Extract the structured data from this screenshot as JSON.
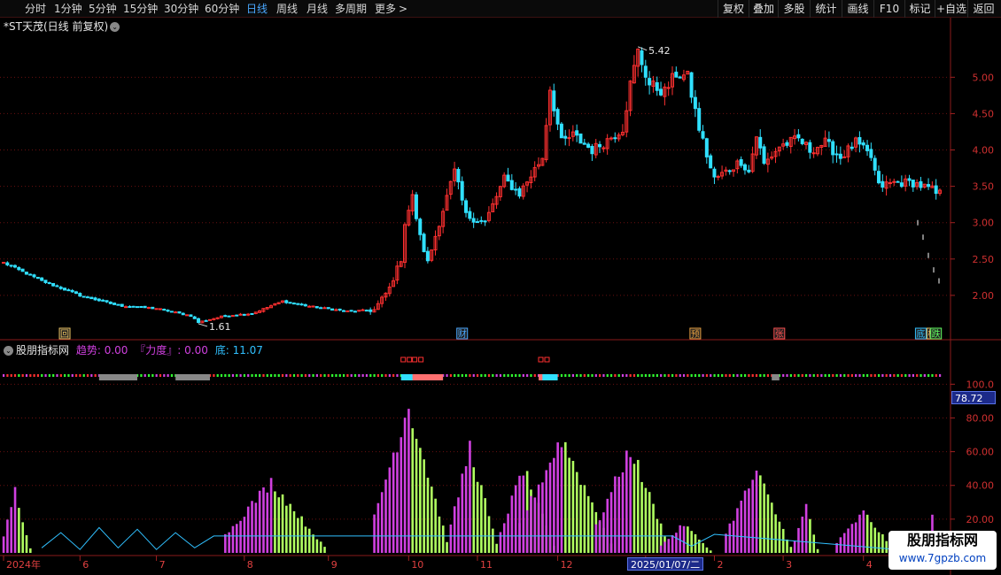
{
  "toolbar": {
    "periods": [
      {
        "label": "分时",
        "name": "tab-minute"
      },
      {
        "label": "1分钟",
        "name": "tab-1min"
      },
      {
        "label": "5分钟",
        "name": "tab-5min"
      },
      {
        "label": "15分钟",
        "name": "tab-15min"
      },
      {
        "label": "30分钟",
        "name": "tab-30min"
      },
      {
        "label": "60分钟",
        "name": "tab-60min"
      },
      {
        "label": "日线",
        "name": "tab-daily"
      },
      {
        "label": "周线",
        "name": "tab-weekly"
      },
      {
        "label": "月线",
        "name": "tab-monthly"
      },
      {
        "label": "多周期",
        "name": "tab-multi-period"
      },
      {
        "label": "更多",
        "name": "tab-more"
      }
    ],
    "more_arrow": ">",
    "active_index": 6,
    "right_buttons": [
      {
        "label": "复权",
        "name": "adjust-button"
      },
      {
        "label": "叠加",
        "name": "overlay-button"
      },
      {
        "label": "多股",
        "name": "multi-stock-button"
      },
      {
        "label": "统计",
        "name": "stats-button"
      },
      {
        "label": "画线",
        "name": "draw-line-button"
      },
      {
        "label": "F10",
        "name": "f10-button"
      },
      {
        "label": "标记",
        "name": "mark-button"
      },
      {
        "label": "+自选",
        "name": "add-watchlist-button"
      },
      {
        "label": "返回",
        "name": "back-button"
      }
    ]
  },
  "price_panel": {
    "title": "*ST天茂(日线 前复权)",
    "high_label": "5.42",
    "low_label": "1.61",
    "event_markers": [
      {
        "text": "回",
        "date": "2024-05-28",
        "color": "#e8c060"
      },
      {
        "text": "财",
        "date": "2024-10-28",
        "color": "#4aa8ff"
      },
      {
        "text": "预",
        "date": "2025-01-21",
        "color": "#e8a040"
      },
      {
        "text": "张",
        "date": "2025-02-28",
        "color": "#ff5050"
      },
      {
        "text": "底",
        "date": "2025-04-22",
        "color": "#30c0ff"
      },
      {
        "text": "榜",
        "date": "2025-04-25",
        "color": "#e8c060"
      },
      {
        "text": "跌",
        "date": "2025-04-28",
        "color": "#60ff60"
      }
    ]
  },
  "indicator_panel": {
    "name": "股朋指标网",
    "trend_label": "趋势",
    "trend_value": "0.00",
    "force_label": "『力度』",
    "force_value": "0.00",
    "bottom_label": "底",
    "bottom_value": "11.07",
    "current_value": "78.72"
  },
  "date_axis": {
    "cursor_date": "2025/01/07/二"
  },
  "watermark": {
    "title": "股朋指标网",
    "url": "www.7gpzb.com"
  },
  "colors": {
    "up": "#ff3030",
    "down": "#30e0ff",
    "magenta_bar": "#d040e0",
    "green_bar": "#b0ff60",
    "line": "#30c0ff",
    "grid": "#6a1010"
  },
  "chart_data": [
    {
      "type": "candlestick",
      "ylim": [
        1.5,
        5.6
      ],
      "ytick_labels": [
        "2.00",
        "2.50",
        "3.00",
        "3.50",
        "4.00",
        "4.50",
        "5.00"
      ],
      "yticks": [
        2.0,
        2.5,
        3.0,
        3.5,
        4.0,
        4.5,
        5.0
      ],
      "xaxis": {
        "ticks": [
          {
            "label": "2024年",
            "date": "2024-05-06"
          },
          {
            "label": "6",
            "date": "2024-06-03"
          },
          {
            "label": "7",
            "date": "2024-07-01"
          },
          {
            "label": "8",
            "date": "2024-08-01"
          },
          {
            "label": "9",
            "date": "2024-09-02"
          },
          {
            "label": "10",
            "date": "2024-10-08"
          },
          {
            "label": "11",
            "date": "2024-11-01"
          },
          {
            "label": "12",
            "date": "2024-12-02"
          },
          {
            "label": "1",
            "date": "2025-01-02"
          },
          {
            "label": "2",
            "date": "2025-02-05"
          },
          {
            "label": "3",
            "date": "2025-03-03"
          },
          {
            "label": "4",
            "date": "2025-04-01"
          }
        ]
      },
      "anchors": [
        {
          "date": "2024-05-06",
          "close": 2.45
        },
        {
          "date": "2024-05-20",
          "close": 2.2
        },
        {
          "date": "2024-06-03",
          "close": 2.0
        },
        {
          "date": "2024-06-17",
          "close": 1.86
        },
        {
          "date": "2024-07-01",
          "close": 1.82
        },
        {
          "date": "2024-07-12",
          "close": 1.72
        },
        {
          "date": "2024-07-16",
          "close": 1.63
        },
        {
          "date": "2024-07-25",
          "close": 1.72
        },
        {
          "date": "2024-08-05",
          "close": 1.75
        },
        {
          "date": "2024-08-15",
          "close": 1.92
        },
        {
          "date": "2024-08-26",
          "close": 1.85
        },
        {
          "date": "2024-09-09",
          "close": 1.78
        },
        {
          "date": "2024-09-18",
          "close": 1.8
        },
        {
          "date": "2024-09-24",
          "close": 2.1
        },
        {
          "date": "2024-09-27",
          "close": 2.5
        },
        {
          "date": "2024-09-30",
          "close": 3.0
        },
        {
          "date": "2024-10-09",
          "close": 3.35
        },
        {
          "date": "2024-10-11",
          "close": 2.8
        },
        {
          "date": "2024-10-15",
          "close": 2.45
        },
        {
          "date": "2024-10-18",
          "close": 3.0
        },
        {
          "date": "2024-10-24",
          "close": 3.7
        },
        {
          "date": "2024-10-29",
          "close": 3.1
        },
        {
          "date": "2024-11-05",
          "close": 3.0
        },
        {
          "date": "2024-11-12",
          "close": 3.6
        },
        {
          "date": "2024-11-18",
          "close": 3.4
        },
        {
          "date": "2024-11-26",
          "close": 3.9
        },
        {
          "date": "2024-11-28",
          "close": 4.85
        },
        {
          "date": "2024-12-03",
          "close": 4.1
        },
        {
          "date": "2024-12-06",
          "close": 4.2
        },
        {
          "date": "2024-12-13",
          "close": 4.0
        },
        {
          "date": "2024-12-18",
          "close": 4.1
        },
        {
          "date": "2024-12-25",
          "close": 4.3
        },
        {
          "date": "2024-12-27",
          "close": 4.9
        },
        {
          "date": "2024-12-31",
          "close": 5.35
        },
        {
          "date": "2025-01-03",
          "close": 4.9
        },
        {
          "date": "2025-01-09",
          "close": 4.8
        },
        {
          "date": "2025-01-14",
          "close": 5.05
        },
        {
          "date": "2025-01-17",
          "close": 5.0
        },
        {
          "date": "2025-01-22",
          "close": 4.3
        },
        {
          "date": "2025-01-27",
          "close": 3.75
        },
        {
          "date": "2025-02-05",
          "close": 3.6
        },
        {
          "date": "2025-02-10",
          "close": 3.7
        },
        {
          "date": "2025-02-14",
          "close": 3.85
        },
        {
          "date": "2025-02-18",
          "close": 3.7
        },
        {
          "date": "2025-02-20",
          "close": 4.2
        },
        {
          "date": "2025-02-24",
          "close": 3.8
        },
        {
          "date": "2025-02-28",
          "close": 4.05
        },
        {
          "date": "2025-03-07",
          "close": 4.15
        },
        {
          "date": "2025-03-12",
          "close": 4.0
        },
        {
          "date": "2025-03-18",
          "close": 4.1
        },
        {
          "date": "2025-03-24",
          "close": 3.9
        },
        {
          "date": "2025-03-28",
          "close": 4.1
        },
        {
          "date": "2025-04-03",
          "close": 3.9
        },
        {
          "date": "2025-04-07",
          "close": 3.5
        },
        {
          "date": "2025-04-11",
          "close": 3.55
        },
        {
          "date": "2025-04-18",
          "close": 3.55
        },
        {
          "date": "2025-04-25",
          "close": 3.45
        },
        {
          "date": "2025-04-28",
          "close": 3.4
        }
      ],
      "after_hours_dashes": [
        3.0,
        2.8,
        2.55,
        2.35,
        2.2
      ]
    },
    {
      "type": "bar",
      "ylim": [
        0,
        118
      ],
      "ytick_labels": [
        "20.00",
        "40.00",
        "60.00",
        "80.00",
        "100.0"
      ],
      "yticks": [
        20,
        40,
        60,
        80,
        100
      ],
      "series": [
        {
          "name": "趋势",
          "segments": [
            {
              "start": "2024-05-06",
              "end": "2024-05-15",
              "peak": 37
            },
            {
              "start": "2024-07-25",
              "end": "2024-08-30",
              "peak": 42
            },
            {
              "start": "2024-09-18",
              "end": "2024-10-22",
              "peak": 88
            },
            {
              "start": "2024-10-23",
              "end": "2024-11-08",
              "peak": 63
            },
            {
              "start": "2024-11-11",
              "end": "2024-11-29",
              "peak": 50
            },
            {
              "start": "2024-11-18",
              "end": "2024-12-20",
              "peak": 68
            },
            {
              "start": "2024-12-16",
              "end": "2025-01-10",
              "peak": 62
            },
            {
              "start": "2025-01-08",
              "end": "2025-01-31",
              "peak": 17
            },
            {
              "start": "2025-02-10",
              "end": "2025-03-05",
              "peak": 48
            },
            {
              "start": "2025-03-06",
              "end": "2025-03-14",
              "peak": 28
            },
            {
              "start": "2025-03-21",
              "end": "2025-04-11",
              "peak": 24
            },
            {
              "start": "2025-04-23",
              "end": "2025-04-29",
              "peak": 22
            }
          ]
        },
        {
          "name": "底",
          "x": [
            "2024-05-20",
            "2024-05-27",
            "2024-06-03",
            "2024-06-10",
            "2024-06-17",
            "2024-06-24",
            "2024-07-01",
            "2024-07-08",
            "2024-07-15",
            "2024-07-22",
            "2025-01-13",
            "2025-01-20",
            "2025-02-05",
            "2025-04-14",
            "2025-04-21"
          ],
          "values": [
            3,
            12,
            2,
            15,
            3,
            14,
            2,
            12,
            3,
            10,
            10,
            4,
            11,
            2,
            11
          ]
        }
      ]
    }
  ]
}
